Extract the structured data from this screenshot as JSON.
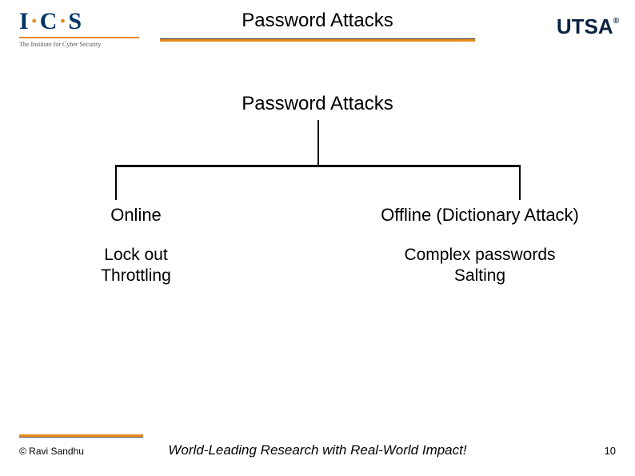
{
  "header": {
    "title": "Password Attacks",
    "logo_left_main": "I·C·S",
    "logo_left_sub": "The Institute for Cyber Security",
    "logo_right": "UTSA"
  },
  "diagram": {
    "root": "Password Attacks",
    "left": {
      "title": "Online",
      "line1": "Lock out",
      "line2": "Throttling"
    },
    "right": {
      "title": "Offline (Dictionary Attack)",
      "line1": "Complex passwords",
      "line2": "Salting"
    }
  },
  "footer": {
    "copyright": "© Ravi  Sandhu",
    "tagline": "World-Leading Research with Real-World Impact!",
    "page": "10"
  }
}
